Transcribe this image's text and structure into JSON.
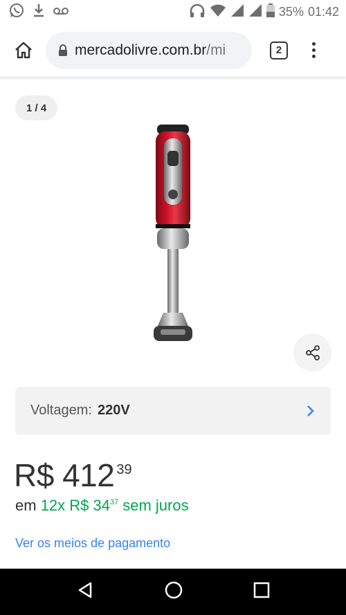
{
  "status_bar": {
    "battery": "35%",
    "time": "01:42",
    "icons": [
      "whatsapp-icon",
      "download-icon",
      "voicemail-icon",
      "headphones-icon",
      "wifi-icon",
      "signal-icon",
      "signal-icon",
      "battery-icon"
    ]
  },
  "browser": {
    "url_domain": "mercadolivre.com.br",
    "url_path": "/mi",
    "tab_count": "2"
  },
  "gallery": {
    "counter": "1 / 4"
  },
  "variant": {
    "label": "Voltagem:",
    "value": "220V"
  },
  "price": {
    "main": "R$ 412",
    "cents": "39"
  },
  "installments": {
    "prefix": "em",
    "count_price": "12x R$ 34",
    "cents": "37",
    "suffix": "sem juros"
  },
  "payment_link": "Ver os meios de pagamento",
  "colors": {
    "accent_blue": "#3483fa",
    "green": "#00a650",
    "product_red": "#c8102e"
  }
}
